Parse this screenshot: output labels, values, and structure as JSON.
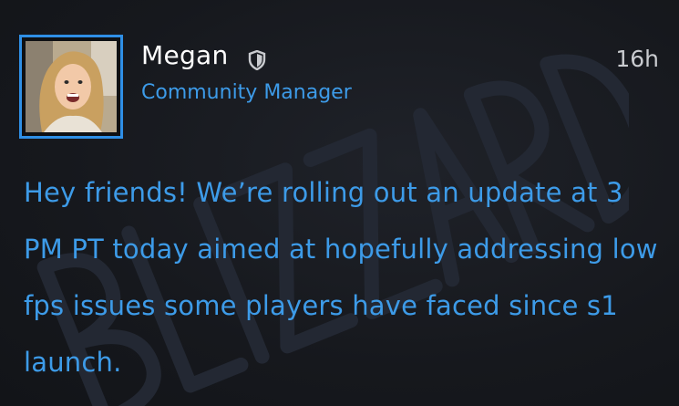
{
  "post": {
    "author_name": "Megan",
    "author_role": "Community Manager",
    "timestamp": "16h",
    "verified_icon": "shield-icon",
    "message": "Hey friends! We’re rolling out an update at 3 PM PT today aimed at hopefully addressing low fps issues some players have faced since s1 launch.",
    "watermark_text": "BLIZZARD"
  },
  "colors": {
    "accent": "#3d9be8",
    "avatar_border": "#2f8fe6",
    "background": "#16181d",
    "name": "#ffffff",
    "timestamp": "#c9cbcf"
  }
}
